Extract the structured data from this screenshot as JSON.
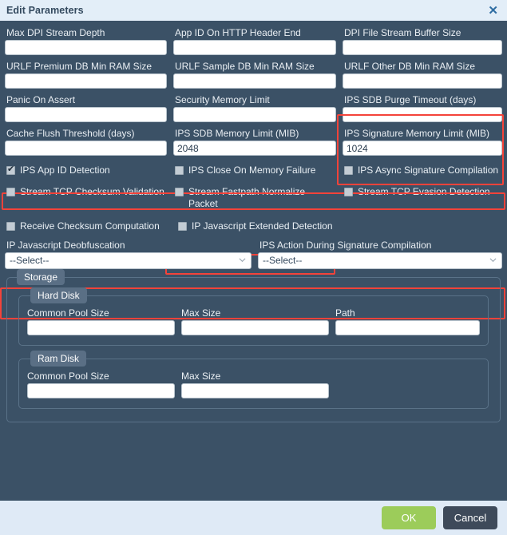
{
  "window": {
    "title": "Edit Parameters",
    "close_icon": "close-icon"
  },
  "fields": {
    "row1": [
      {
        "label": "Max DPI Stream Depth",
        "value": "",
        "name": "max-dpi-stream-depth"
      },
      {
        "label": "App ID On HTTP Header End",
        "value": "",
        "name": "app-id-on-http-header-end"
      },
      {
        "label": "DPI File Stream Buffer Size",
        "value": "",
        "name": "dpi-file-stream-buffer-size"
      }
    ],
    "row2": [
      {
        "label": "URLF Premium DB Min RAM Size",
        "value": "",
        "name": "urlf-premium-db-min-ram-size"
      },
      {
        "label": "URLF Sample DB Min RAM Size",
        "value": "",
        "name": "urlf-sample-db-min-ram-size"
      },
      {
        "label": "URLF Other DB Min RAM Size",
        "value": "",
        "name": "urlf-other-db-min-ram-size"
      }
    ],
    "row3": [
      {
        "label": "Panic On Assert",
        "value": "",
        "name": "panic-on-assert"
      },
      {
        "label": "Security Memory Limit",
        "value": "",
        "name": "security-memory-limit"
      },
      {
        "label": "IPS SDB Purge Timeout (days)",
        "value": "",
        "name": "ips-sdb-purge-timeout"
      }
    ],
    "row4": [
      {
        "label": "Cache Flush Threshold (days)",
        "value": "",
        "name": "cache-flush-threshold"
      },
      {
        "label": "IPS SDB Memory Limit (MIB)",
        "value": "2048",
        "name": "ips-sdb-memory-limit"
      },
      {
        "label": "IPS Signature Memory Limit (MIB)",
        "value": "1024",
        "name": "ips-signature-memory-limit"
      }
    ]
  },
  "checkboxes": {
    "row1": [
      {
        "label": "IPS App ID Detection",
        "checked": true,
        "name": "ips-app-id-detection"
      },
      {
        "label": "IPS Close On Memory Failure",
        "checked": false,
        "name": "ips-close-on-memory-failure"
      },
      {
        "label": "IPS Async Signature Compilation",
        "checked": false,
        "name": "ips-async-signature-compilation"
      }
    ],
    "row2": [
      {
        "label": "Stream TCP Checksum Validation",
        "checked": false,
        "name": "stream-tcp-checksum-validation"
      },
      {
        "label": "Stream Fastpath Normalize Packet",
        "checked": false,
        "name": "stream-fastpath-normalize-packet"
      },
      {
        "label": "Stream TCP Evasion Detection",
        "checked": false,
        "name": "stream-tcp-evasion-detection"
      }
    ],
    "row3": [
      {
        "label": "Receive Checksum Computation",
        "checked": false,
        "name": "receive-checksum-computation"
      },
      {
        "label": "IP Javascript Extended Detection",
        "checked": false,
        "name": "ip-javascript-extended-detection"
      }
    ]
  },
  "selects": [
    {
      "label": "IP Javascript Deobfuscation",
      "value": "--Select--",
      "name": "ip-javascript-deobfuscation"
    },
    {
      "label": "IPS Action During Signature Compilation",
      "value": "--Select--",
      "name": "ips-action-during-signature-compilation"
    }
  ],
  "storage": {
    "legend": "Storage",
    "hard_disk": {
      "legend": "Hard Disk",
      "fields": [
        {
          "label": "Common Pool Size",
          "value": "",
          "name": "hard-disk-common-pool-size"
        },
        {
          "label": "Max Size",
          "value": "",
          "name": "hard-disk-max-size"
        },
        {
          "label": "Path",
          "value": "",
          "name": "hard-disk-path"
        }
      ]
    },
    "ram_disk": {
      "legend": "Ram Disk",
      "fields": [
        {
          "label": "Common Pool Size",
          "value": "",
          "name": "ram-disk-common-pool-size"
        },
        {
          "label": "Max Size",
          "value": "",
          "name": "ram-disk-max-size"
        }
      ]
    }
  },
  "footer": {
    "ok_label": "OK",
    "cancel_label": "Cancel"
  },
  "colors": {
    "highlight": "#f4433a",
    "ok_button": "#9ccc5a",
    "cancel_button": "#3e4a5a",
    "body_bg": "#3b5166",
    "titlebar_bg": "#e3eef8"
  }
}
